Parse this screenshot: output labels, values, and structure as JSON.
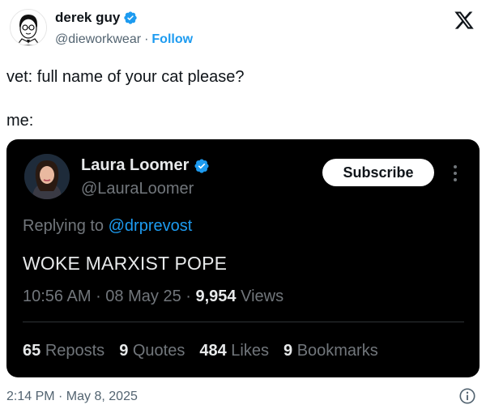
{
  "outer_tweet": {
    "author_name": "derek guy",
    "author_handle": "@dieworkwear",
    "separator": "·",
    "follow_label": "Follow",
    "text_line_1": "vet: full name of your cat please?",
    "text_line_2": "me:",
    "timestamp": "2:14 PM · May 8, 2025"
  },
  "embedded_tweet": {
    "author_name": "Laura Loomer",
    "author_handle": "@LauraLoomer",
    "subscribe_label": "Subscribe",
    "replying_prefix": "Replying to ",
    "replying_mention": "@drprevost",
    "text": "WOKE MARXIST POPE",
    "time": "10:56 AM",
    "date": "08 May 25",
    "views_count": "9,954",
    "views_label": "Views",
    "stats": [
      {
        "count": "65",
        "label": "Reposts"
      },
      {
        "count": "9",
        "label": "Quotes"
      },
      {
        "count": "484",
        "label": "Likes"
      },
      {
        "count": "9",
        "label": "Bookmarks"
      }
    ]
  },
  "icons": {
    "verified": "verified-badge-icon",
    "x_logo": "x-logo-icon",
    "more": "more-vertical-icon",
    "info": "info-icon"
  },
  "colors": {
    "accent": "#1d9bf0",
    "text_primary": "#0f1419",
    "text_secondary": "#536471",
    "dark_bg": "#000000",
    "dark_text": "#e7e9ea",
    "dark_secondary": "#71767b"
  }
}
